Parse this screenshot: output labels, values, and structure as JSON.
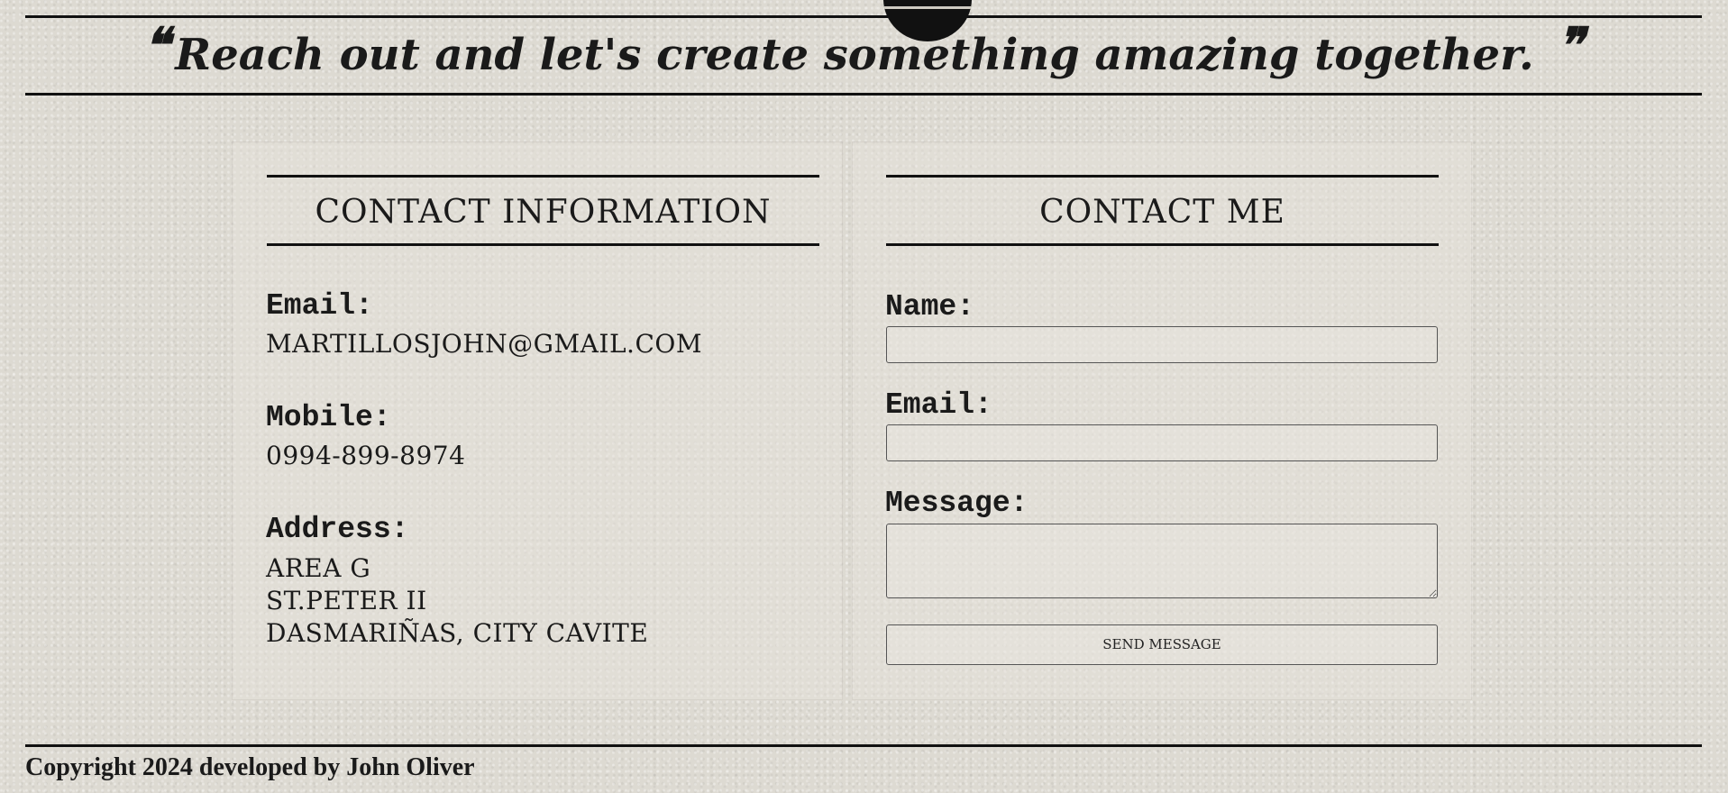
{
  "quote": {
    "open_mark": "❝",
    "text": "Reach out and let's create something amazing together.",
    "close_mark": "❞"
  },
  "contact_info": {
    "title": "Contact Information",
    "email_label": "Email:",
    "email_value": "martillosjohn@gmail.com",
    "mobile_label": "Mobile:",
    "mobile_value": "0994-899-8974",
    "address_label": "Address:",
    "address_lines": [
      "Area G",
      "St.Peter II",
      "Dasmariñas, City Cavite"
    ]
  },
  "contact_form": {
    "title": "Contact Me",
    "name_label": "Name:",
    "name_value": "",
    "email_label": "Email:",
    "email_value": "",
    "message_label": "Message:",
    "message_value": "",
    "send_label": "Send Message"
  },
  "footer": {
    "copyright": "Copyright 2024 developed by John Oliver"
  }
}
